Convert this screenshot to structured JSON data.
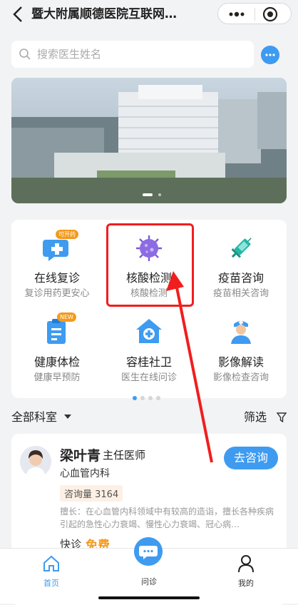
{
  "header": {
    "title": "暨大附属顺德医院互联网…"
  },
  "search": {
    "placeholder": "搜索医生姓名"
  },
  "services": [
    {
      "label": "在线复诊",
      "sub": "复诊用药更安心",
      "badge": "可开药",
      "icon": "chat-plus-icon"
    },
    {
      "label": "核酸检测",
      "sub": "核酸检测",
      "icon": "virus-icon"
    },
    {
      "label": "疫苗咨询",
      "sub": "疫苗相关咨询",
      "icon": "syringe-icon"
    },
    {
      "label": "健康体检",
      "sub": "健康早预防",
      "badge": "NEW",
      "icon": "clipboard-icon"
    },
    {
      "label": "容桂社卫",
      "sub": "医生在线问诊",
      "icon": "clinic-house-icon"
    },
    {
      "label": "影像解读",
      "sub": "影像检查咨询",
      "icon": "nurse-icon"
    }
  ],
  "filters": {
    "department": "全部科室",
    "filter": "筛选"
  },
  "doctor": {
    "name": "梁叶青",
    "title": "主任医师",
    "dept": "心血管内科",
    "consult_button": "去咨询",
    "count": "咨询量 3164",
    "desc": "擅长：在心血管内科领域中有较高的造诣，擅长各种疾病引起的急性心力衰竭、慢性心力衰竭、冠心病…",
    "quick": "快诊",
    "free": "免费"
  },
  "tabbar": {
    "home": "首页",
    "consult": "问诊",
    "mine": "我的"
  },
  "colors": {
    "accent": "#3e9bf0",
    "highlight": "#f01e1e",
    "free": "#f49a1c"
  }
}
